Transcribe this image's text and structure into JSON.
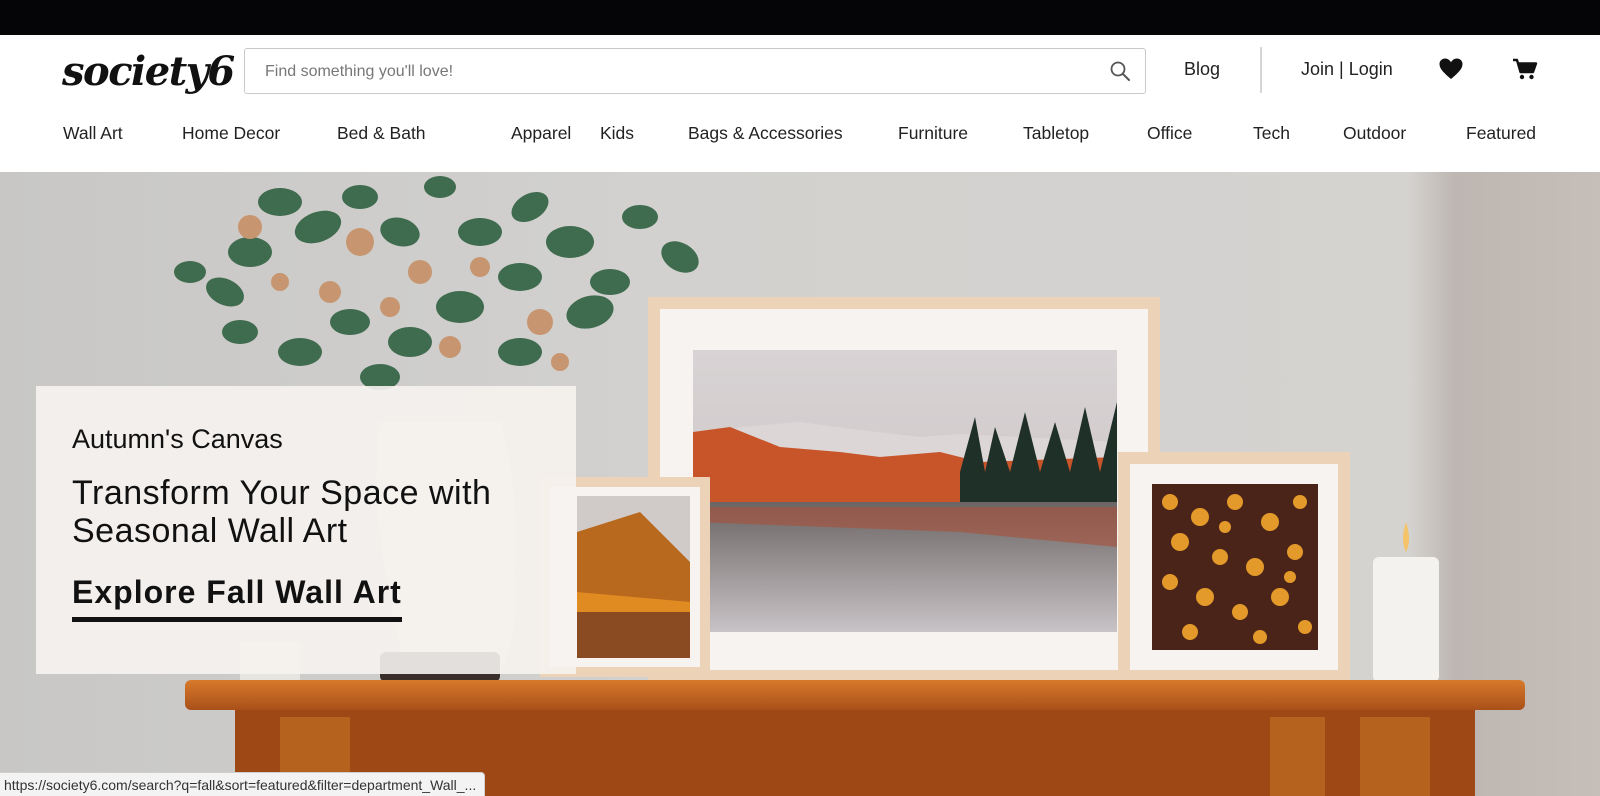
{
  "brand": {
    "logo_text": "society6"
  },
  "search": {
    "placeholder": "Find something you'll love!",
    "value": "",
    "icon": "search-icon"
  },
  "header": {
    "blog_label": "Blog",
    "account_label": "Join | Login",
    "wishlist_icon": "heart-icon",
    "cart_icon": "cart-icon"
  },
  "nav": {
    "categories": [
      "Wall Art",
      "Home Decor",
      "Bed & Bath",
      "Apparel",
      "Kids",
      "Bags & Accessories",
      "Furniture",
      "Tabletop",
      "Office",
      "Tech",
      "Outdoor",
      "Featured"
    ]
  },
  "hero": {
    "kicker": "Autumn's Canvas",
    "headline": "Transform Your Space with Seasonal Wall Art",
    "cta_label": "Explore Fall Wall Art"
  },
  "status_bar": {
    "url": "https://society6.com/search?q=fall&sort=featured&filter=department_Wall_..."
  },
  "colors": {
    "top_bar": "#050508",
    "text": "#111111",
    "mantel_wood": "#b85a1a",
    "frame_wood": "#ecd3b8"
  }
}
